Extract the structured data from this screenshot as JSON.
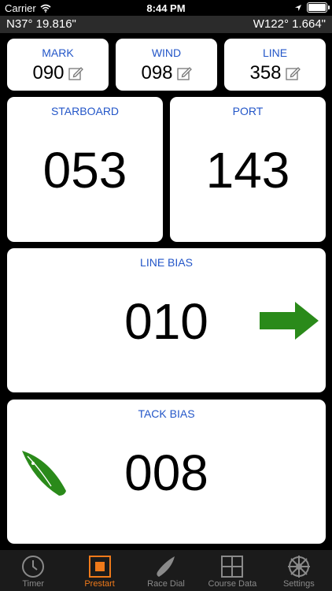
{
  "status_bar": {
    "carrier": "Carrier",
    "time": "8:44 PM"
  },
  "coords": {
    "lat": "N37° 19.816\"",
    "lon": "W122° 1.664\""
  },
  "top_row": [
    {
      "label": "MARK",
      "value": "090"
    },
    {
      "label": "WIND",
      "value": "098"
    },
    {
      "label": "LINE",
      "value": "358"
    }
  ],
  "starboard": {
    "label": "STARBOARD",
    "value": "053"
  },
  "port": {
    "label": "PORT",
    "value": "143"
  },
  "line_bias": {
    "label": "LINE BIAS",
    "value": "010",
    "arrow_color": "#2a8a1a"
  },
  "tack_bias": {
    "label": "TACK BIAS",
    "value": "008",
    "boat_color": "#2a8a1a"
  },
  "tabs": [
    {
      "label": "Timer",
      "icon": "clock-icon"
    },
    {
      "label": "Prestart",
      "icon": "prestart-icon",
      "active": true
    },
    {
      "label": "Race Dial",
      "icon": "sail-icon"
    },
    {
      "label": "Course Data",
      "icon": "grid-icon"
    },
    {
      "label": "Settings",
      "icon": "wheel-icon"
    }
  ],
  "colors": {
    "accent": "#2356c8",
    "active_tab": "#f07a1a",
    "bias_green": "#2a8a1a"
  }
}
